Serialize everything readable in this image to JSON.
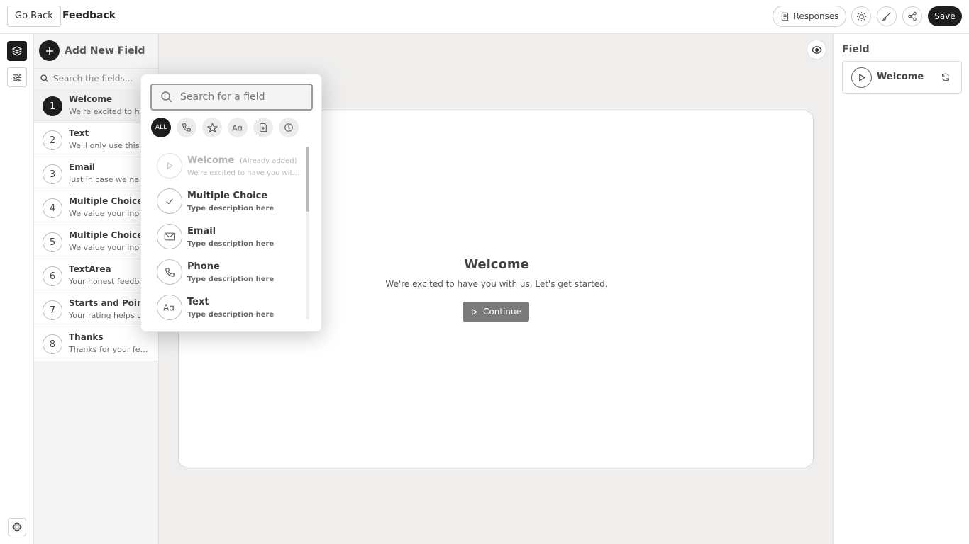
{
  "header": {
    "back_label": "Go Back",
    "title": "Feedback",
    "responses_label": "Responses",
    "save_label": "Save",
    "icons": [
      "document-icon",
      "sun-icon",
      "brush-icon",
      "share-icon"
    ]
  },
  "rail": {
    "icons": [
      "layers-icon",
      "sliders-icon",
      "gear-icon"
    ]
  },
  "fields_panel": {
    "add_label": "Add New Field",
    "search_placeholder": "Search the fields...",
    "items": [
      {
        "num": "1",
        "title": "Welcome",
        "desc": "We're excited to have you with us",
        "selected": true
      },
      {
        "num": "2",
        "title": "Text",
        "desc": "We'll only use this ..."
      },
      {
        "num": "3",
        "title": "Email",
        "desc": "Just in case we need ..."
      },
      {
        "num": "4",
        "title": "Multiple Choice",
        "desc": "We value your input ..."
      },
      {
        "num": "5",
        "title": "Multiple Choice",
        "desc": "We value your input ..."
      },
      {
        "num": "6",
        "title": "TextArea",
        "desc": "Your honest feedback ..."
      },
      {
        "num": "7",
        "title": "Starts and Points",
        "desc": "Your rating helps us ..."
      },
      {
        "num": "8",
        "title": "Thanks",
        "desc": "Thanks for your feed ..."
      }
    ]
  },
  "preview": {
    "title": "Welcome",
    "desc": "We're excited to have you with us, Let's get started.",
    "button_label": "Continue"
  },
  "right_panel": {
    "title": "Field",
    "selected_field": "Welcome"
  },
  "popup": {
    "search_placeholder": "Search for a field",
    "filters": [
      "ALL",
      "phone-icon",
      "star-icon",
      "text-icon",
      "file-add-icon",
      "clock-icon"
    ],
    "active_filter": "ALL",
    "items": [
      {
        "title": "Welcome",
        "note": "(Already added)",
        "desc": "We're excited to have you with us",
        "icon": "play-icon",
        "disabled": true
      },
      {
        "title": "Multiple Choice",
        "desc": "Type description here",
        "icon": "check-icon"
      },
      {
        "title": "Email",
        "desc": "Type description here",
        "icon": "mail-icon"
      },
      {
        "title": "Phone",
        "desc": "Type description here",
        "icon": "phone-icon"
      },
      {
        "title": "Text",
        "desc": "Type description here",
        "icon": "text-icon"
      }
    ]
  },
  "colors": {
    "dark": "#1e1e1e",
    "canvas_bg": "#efeeed",
    "button_gray": "#7a7a7a"
  }
}
